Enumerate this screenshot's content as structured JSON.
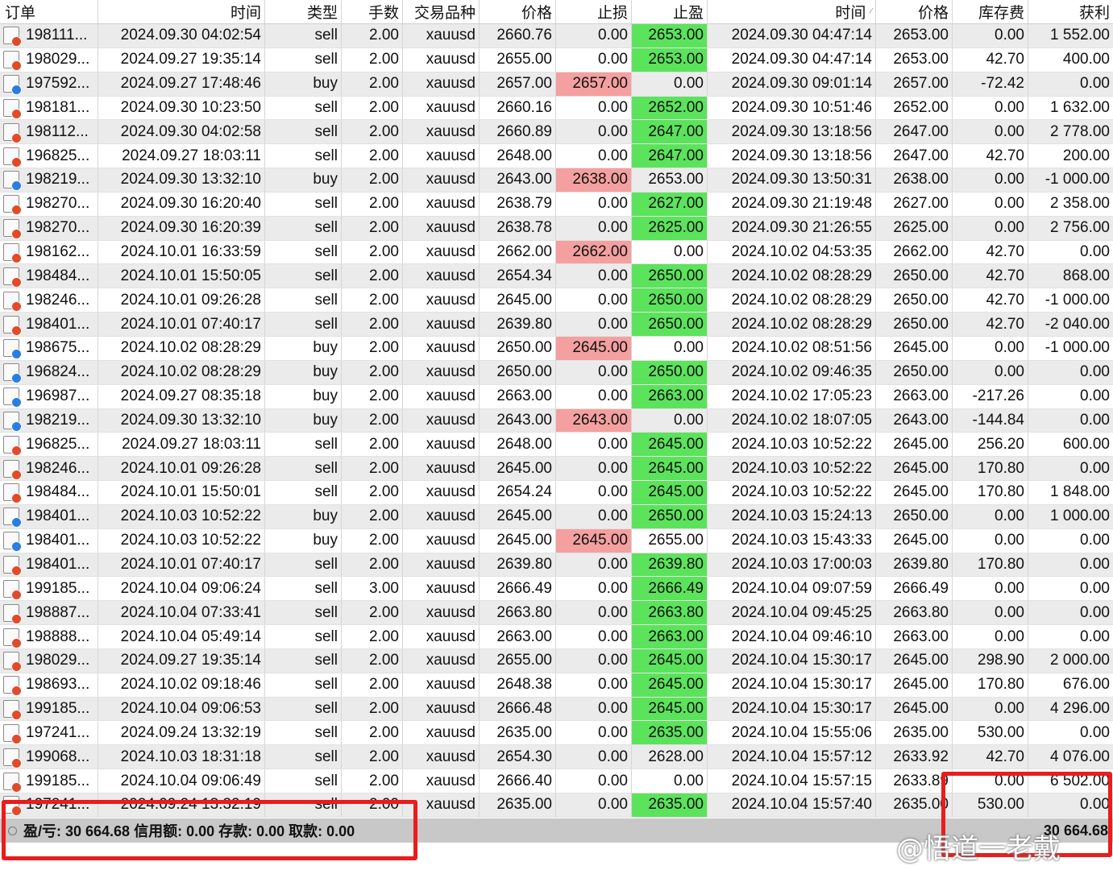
{
  "headers": [
    "订单",
    "时间",
    "类型",
    "手数",
    "交易品种",
    "价格",
    "止损",
    "止盈",
    "时间",
    "价格",
    "库存费",
    "获利"
  ],
  "rows": [
    {
      "order": "198111...",
      "open_time": "2024.09.30 04:02:54",
      "type": "sell",
      "lots": "2.00",
      "symbol": "xauusd",
      "open_price": "2660.76",
      "sl": "0.00",
      "tp": "2653.00",
      "close_time": "2024.09.30 04:47:14",
      "close_price": "2653.00",
      "swap": "0.00",
      "profit": "1 552.00",
      "sl_hit": false,
      "tp_hit": true
    },
    {
      "order": "198029...",
      "open_time": "2024.09.27 19:35:14",
      "type": "sell",
      "lots": "2.00",
      "symbol": "xauusd",
      "open_price": "2655.00",
      "sl": "0.00",
      "tp": "2653.00",
      "close_time": "2024.09.30 04:47:14",
      "close_price": "2653.00",
      "swap": "42.70",
      "profit": "400.00",
      "sl_hit": false,
      "tp_hit": true
    },
    {
      "order": "197592...",
      "open_time": "2024.09.27 17:48:46",
      "type": "buy",
      "lots": "2.00",
      "symbol": "xauusd",
      "open_price": "2657.00",
      "sl": "2657.00",
      "tp": "0.00",
      "close_time": "2024.09.30 09:01:14",
      "close_price": "2657.00",
      "swap": "-72.42",
      "profit": "0.00",
      "sl_hit": true,
      "tp_hit": false
    },
    {
      "order": "198181...",
      "open_time": "2024.09.30 10:23:50",
      "type": "sell",
      "lots": "2.00",
      "symbol": "xauusd",
      "open_price": "2660.16",
      "sl": "0.00",
      "tp": "2652.00",
      "close_time": "2024.09.30 10:51:46",
      "close_price": "2652.00",
      "swap": "0.00",
      "profit": "1 632.00",
      "sl_hit": false,
      "tp_hit": true
    },
    {
      "order": "198112...",
      "open_time": "2024.09.30 04:02:58",
      "type": "sell",
      "lots": "2.00",
      "symbol": "xauusd",
      "open_price": "2660.89",
      "sl": "0.00",
      "tp": "2647.00",
      "close_time": "2024.09.30 13:18:56",
      "close_price": "2647.00",
      "swap": "0.00",
      "profit": "2 778.00",
      "sl_hit": false,
      "tp_hit": true
    },
    {
      "order": "196825...",
      "open_time": "2024.09.27 18:03:11",
      "type": "sell",
      "lots": "2.00",
      "symbol": "xauusd",
      "open_price": "2648.00",
      "sl": "0.00",
      "tp": "2647.00",
      "close_time": "2024.09.30 13:18:56",
      "close_price": "2647.00",
      "swap": "42.70",
      "profit": "200.00",
      "sl_hit": false,
      "tp_hit": true
    },
    {
      "order": "198219...",
      "open_time": "2024.09.30 13:32:10",
      "type": "buy",
      "lots": "2.00",
      "symbol": "xauusd",
      "open_price": "2643.00",
      "sl": "2638.00",
      "tp": "2653.00",
      "close_time": "2024.09.30 13:50:31",
      "close_price": "2638.00",
      "swap": "0.00",
      "profit": "-1 000.00",
      "sl_hit": true,
      "tp_hit": false
    },
    {
      "order": "198270...",
      "open_time": "2024.09.30 16:20:40",
      "type": "sell",
      "lots": "2.00",
      "symbol": "xauusd",
      "open_price": "2638.79",
      "sl": "0.00",
      "tp": "2627.00",
      "close_time": "2024.09.30 21:19:48",
      "close_price": "2627.00",
      "swap": "0.00",
      "profit": "2 358.00",
      "sl_hit": false,
      "tp_hit": true
    },
    {
      "order": "198270...",
      "open_time": "2024.09.30 16:20:39",
      "type": "sell",
      "lots": "2.00",
      "symbol": "xauusd",
      "open_price": "2638.78",
      "sl": "0.00",
      "tp": "2625.00",
      "close_time": "2024.09.30 21:26:55",
      "close_price": "2625.00",
      "swap": "0.00",
      "profit": "2 756.00",
      "sl_hit": false,
      "tp_hit": true
    },
    {
      "order": "198162...",
      "open_time": "2024.10.01 16:33:59",
      "type": "sell",
      "lots": "2.00",
      "symbol": "xauusd",
      "open_price": "2662.00",
      "sl": "2662.00",
      "tp": "0.00",
      "close_time": "2024.10.02 04:53:35",
      "close_price": "2662.00",
      "swap": "42.70",
      "profit": "0.00",
      "sl_hit": true,
      "tp_hit": false
    },
    {
      "order": "198484...",
      "open_time": "2024.10.01 15:50:05",
      "type": "sell",
      "lots": "2.00",
      "symbol": "xauusd",
      "open_price": "2654.34",
      "sl": "0.00",
      "tp": "2650.00",
      "close_time": "2024.10.02 08:28:29",
      "close_price": "2650.00",
      "swap": "42.70",
      "profit": "868.00",
      "sl_hit": false,
      "tp_hit": true
    },
    {
      "order": "198246...",
      "open_time": "2024.10.01 09:26:28",
      "type": "sell",
      "lots": "2.00",
      "symbol": "xauusd",
      "open_price": "2645.00",
      "sl": "0.00",
      "tp": "2650.00",
      "close_time": "2024.10.02 08:28:29",
      "close_price": "2650.00",
      "swap": "42.70",
      "profit": "-1 000.00",
      "sl_hit": false,
      "tp_hit": true
    },
    {
      "order": "198401...",
      "open_time": "2024.10.01 07:40:17",
      "type": "sell",
      "lots": "2.00",
      "symbol": "xauusd",
      "open_price": "2639.80",
      "sl": "0.00",
      "tp": "2650.00",
      "close_time": "2024.10.02 08:28:29",
      "close_price": "2650.00",
      "swap": "42.70",
      "profit": "-2 040.00",
      "sl_hit": false,
      "tp_hit": true
    },
    {
      "order": "198675...",
      "open_time": "2024.10.02 08:28:29",
      "type": "buy",
      "lots": "2.00",
      "symbol": "xauusd",
      "open_price": "2650.00",
      "sl": "2645.00",
      "tp": "0.00",
      "close_time": "2024.10.02 08:51:56",
      "close_price": "2645.00",
      "swap": "0.00",
      "profit": "-1 000.00",
      "sl_hit": true,
      "tp_hit": false
    },
    {
      "order": "196824...",
      "open_time": "2024.10.02 08:28:29",
      "type": "buy",
      "lots": "2.00",
      "symbol": "xauusd",
      "open_price": "2650.00",
      "sl": "0.00",
      "tp": "2650.00",
      "close_time": "2024.10.02 09:46:35",
      "close_price": "2650.00",
      "swap": "0.00",
      "profit": "0.00",
      "sl_hit": false,
      "tp_hit": true
    },
    {
      "order": "196987...",
      "open_time": "2024.09.27 08:35:18",
      "type": "buy",
      "lots": "2.00",
      "symbol": "xauusd",
      "open_price": "2663.00",
      "sl": "0.00",
      "tp": "2663.00",
      "close_time": "2024.10.02 17:05:23",
      "close_price": "2663.00",
      "swap": "-217.26",
      "profit": "0.00",
      "sl_hit": false,
      "tp_hit": true
    },
    {
      "order": "198219...",
      "open_time": "2024.09.30 13:32:10",
      "type": "buy",
      "lots": "2.00",
      "symbol": "xauusd",
      "open_price": "2643.00",
      "sl": "2643.00",
      "tp": "0.00",
      "close_time": "2024.10.02 18:07:05",
      "close_price": "2643.00",
      "swap": "-144.84",
      "profit": "0.00",
      "sl_hit": true,
      "tp_hit": false
    },
    {
      "order": "196825...",
      "open_time": "2024.09.27 18:03:11",
      "type": "sell",
      "lots": "2.00",
      "symbol": "xauusd",
      "open_price": "2648.00",
      "sl": "0.00",
      "tp": "2645.00",
      "close_time": "2024.10.03 10:52:22",
      "close_price": "2645.00",
      "swap": "256.20",
      "profit": "600.00",
      "sl_hit": false,
      "tp_hit": true
    },
    {
      "order": "198246...",
      "open_time": "2024.10.01 09:26:28",
      "type": "sell",
      "lots": "2.00",
      "symbol": "xauusd",
      "open_price": "2645.00",
      "sl": "0.00",
      "tp": "2645.00",
      "close_time": "2024.10.03 10:52:22",
      "close_price": "2645.00",
      "swap": "170.80",
      "profit": "0.00",
      "sl_hit": false,
      "tp_hit": true
    },
    {
      "order": "198484...",
      "open_time": "2024.10.01 15:50:01",
      "type": "sell",
      "lots": "2.00",
      "symbol": "xauusd",
      "open_price": "2654.24",
      "sl": "0.00",
      "tp": "2645.00",
      "close_time": "2024.10.03 10:52:22",
      "close_price": "2645.00",
      "swap": "170.80",
      "profit": "1 848.00",
      "sl_hit": false,
      "tp_hit": true
    },
    {
      "order": "198401...",
      "open_time": "2024.10.03 10:52:22",
      "type": "buy",
      "lots": "2.00",
      "symbol": "xauusd",
      "open_price": "2645.00",
      "sl": "0.00",
      "tp": "2650.00",
      "close_time": "2024.10.03 15:24:13",
      "close_price": "2650.00",
      "swap": "0.00",
      "profit": "1 000.00",
      "sl_hit": false,
      "tp_hit": true
    },
    {
      "order": "198401...",
      "open_time": "2024.10.03 10:52:22",
      "type": "buy",
      "lots": "2.00",
      "symbol": "xauusd",
      "open_price": "2645.00",
      "sl": "2645.00",
      "tp": "2655.00",
      "close_time": "2024.10.03 15:43:33",
      "close_price": "2645.00",
      "swap": "0.00",
      "profit": "0.00",
      "sl_hit": true,
      "tp_hit": false
    },
    {
      "order": "198401...",
      "open_time": "2024.10.01 07:40:17",
      "type": "sell",
      "lots": "2.00",
      "symbol": "xauusd",
      "open_price": "2639.80",
      "sl": "0.00",
      "tp": "2639.80",
      "close_time": "2024.10.03 17:00:03",
      "close_price": "2639.80",
      "swap": "170.80",
      "profit": "0.00",
      "sl_hit": false,
      "tp_hit": true
    },
    {
      "order": "199185...",
      "open_time": "2024.10.04 09:06:24",
      "type": "sell",
      "lots": "3.00",
      "symbol": "xauusd",
      "open_price": "2666.49",
      "sl": "0.00",
      "tp": "2666.49",
      "close_time": "2024.10.04 09:07:59",
      "close_price": "2666.49",
      "swap": "0.00",
      "profit": "0.00",
      "sl_hit": false,
      "tp_hit": true
    },
    {
      "order": "198887...",
      "open_time": "2024.10.04 07:33:41",
      "type": "sell",
      "lots": "2.00",
      "symbol": "xauusd",
      "open_price": "2663.80",
      "sl": "0.00",
      "tp": "2663.80",
      "close_time": "2024.10.04 09:45:25",
      "close_price": "2663.80",
      "swap": "0.00",
      "profit": "0.00",
      "sl_hit": false,
      "tp_hit": true
    },
    {
      "order": "198888...",
      "open_time": "2024.10.04 05:49:14",
      "type": "sell",
      "lots": "2.00",
      "symbol": "xauusd",
      "open_price": "2663.00",
      "sl": "0.00",
      "tp": "2663.00",
      "close_time": "2024.10.04 09:46:10",
      "close_price": "2663.00",
      "swap": "0.00",
      "profit": "0.00",
      "sl_hit": false,
      "tp_hit": true
    },
    {
      "order": "198029...",
      "open_time": "2024.09.27 19:35:14",
      "type": "sell",
      "lots": "2.00",
      "symbol": "xauusd",
      "open_price": "2655.00",
      "sl": "0.00",
      "tp": "2645.00",
      "close_time": "2024.10.04 15:30:17",
      "close_price": "2645.00",
      "swap": "298.90",
      "profit": "2 000.00",
      "sl_hit": false,
      "tp_hit": true
    },
    {
      "order": "198693...",
      "open_time": "2024.10.02 09:18:46",
      "type": "sell",
      "lots": "2.00",
      "symbol": "xauusd",
      "open_price": "2648.38",
      "sl": "0.00",
      "tp": "2645.00",
      "close_time": "2024.10.04 15:30:17",
      "close_price": "2645.00",
      "swap": "170.80",
      "profit": "676.00",
      "sl_hit": false,
      "tp_hit": true
    },
    {
      "order": "199185...",
      "open_time": "2024.10.04 09:06:53",
      "type": "sell",
      "lots": "2.00",
      "symbol": "xauusd",
      "open_price": "2666.48",
      "sl": "0.00",
      "tp": "2645.00",
      "close_time": "2024.10.04 15:30:17",
      "close_price": "2645.00",
      "swap": "0.00",
      "profit": "4 296.00",
      "sl_hit": false,
      "tp_hit": true
    },
    {
      "order": "197241...",
      "open_time": "2024.09.24 13:32:19",
      "type": "sell",
      "lots": "2.00",
      "symbol": "xauusd",
      "open_price": "2635.00",
      "sl": "0.00",
      "tp": "2635.00",
      "close_time": "2024.10.04 15:55:06",
      "close_price": "2635.00",
      "swap": "530.00",
      "profit": "0.00",
      "sl_hit": false,
      "tp_hit": true
    },
    {
      "order": "199068...",
      "open_time": "2024.10.03 18:31:18",
      "type": "sell",
      "lots": "2.00",
      "symbol": "xauusd",
      "open_price": "2654.30",
      "sl": "0.00",
      "tp": "2628.00",
      "close_time": "2024.10.04 15:57:12",
      "close_price": "2633.92",
      "swap": "42.70",
      "profit": "4 076.00",
      "sl_hit": false,
      "tp_hit": false
    },
    {
      "order": "199185...",
      "open_time": "2024.10.04 09:06:49",
      "type": "sell",
      "lots": "2.00",
      "symbol": "xauusd",
      "open_price": "2666.40",
      "sl": "0.00",
      "tp": "0.00",
      "close_time": "2024.10.04 15:57:15",
      "close_price": "2633.89",
      "swap": "0.00",
      "profit": "6 502.00",
      "sl_hit": false,
      "tp_hit": false
    },
    {
      "order": "197241...",
      "open_time": "2024.09.24 13:32:19",
      "type": "sell",
      "lots": "2.00",
      "symbol": "xauusd",
      "open_price": "2635.00",
      "sl": "0.00",
      "tp": "2635.00",
      "close_time": "2024.10.04 15:57:40",
      "close_price": "2635.00",
      "swap": "530.00",
      "profit": "0.00",
      "sl_hit": false,
      "tp_hit": true
    }
  ],
  "status": {
    "summary": "盈/亏: 30 664.68  信用额: 0.00  存款: 0.00  取款: 0.00",
    "total_profit": "30 664.68"
  },
  "watermark": "@悟道一老戴",
  "colors": {
    "sl_highlight": "#f4a0a0",
    "tp_highlight": "#5be35b",
    "sell_icon_dot": "#e04b2a",
    "buy_icon_dot": "#2a7ee0",
    "annotation_box": "#ea1c1c"
  }
}
